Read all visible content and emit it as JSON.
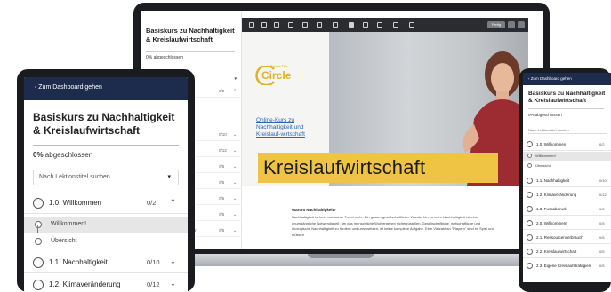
{
  "laptop": {
    "sidebar": {
      "title": "Basiskurs zu Nachhaltigkeit & Kreislaufwirtschaft",
      "progress": "0% abgeschlossen",
      "search_placeholder": "Nach Lektionstitel suchen",
      "rows": [
        {
          "label": "",
          "count": "0/2"
        },
        {
          "label": "",
          "count": "0/10"
        },
        {
          "label": "ng",
          "count": "0/12"
        },
        {
          "label": "",
          "count": "0/5"
        },
        {
          "label": "",
          "count": "0/5"
        },
        {
          "label": "ruch",
          "count": "0/6"
        },
        {
          "label": "",
          "count": "0/5"
        },
        {
          "label": "strategien",
          "count": "0/5"
        },
        {
          "label": "",
          "count": "0/7"
        }
      ]
    },
    "toolbar": {
      "button_label": "Fertig"
    },
    "slide": {
      "brand_small": "Shape The",
      "brand_big": "Circle",
      "subtitle": "Online-Kurs zu Nachhaltigkeit und Kreislauf-wirtschaft",
      "banner": "Kreislaufwirtschaft"
    },
    "article": {
      "title": "Warum Nachhaltigkeit?",
      "body": "Nachhaltigkeit ist kein modischer Trend mehr. Ein gesamtgesellschaftlicher Wandel hin zu mehr Nachhaltigkeit ist eine unumgängliche Notwendigkeit, um das menschliche Wohlergehen sicherzustellen. Gesellschaftliche, wirtschaftliche und ökologische Nachhaltigkeit zu fördern und umzusetzen, ist keine komplexe Aufgabe. Eine Vielzahl an \"Playern\" sind im Spiel und müssen"
    }
  },
  "tablet": {
    "back_label": "Zum Dashboard gehen",
    "title": "Basiskurs zu Nachhaltigkeit & Kreislaufwirtschaft",
    "progress_value": "0%",
    "progress_text": "abgeschlossen",
    "search_placeholder": "Nach Lektionstitel suchen",
    "sections": [
      {
        "label": "1.0. Willkommen",
        "count": "0/2",
        "chevron": "up"
      },
      {
        "label": "1.1. Nachhaltigkeit",
        "count": "0/10",
        "chevron": "down"
      },
      {
        "label": "1.2. Klimaveränderung",
        "count": "0/12",
        "chevron": "down"
      }
    ],
    "items": [
      {
        "label": "Willkommen!",
        "active": true
      },
      {
        "label": "Übersicht",
        "active": false
      }
    ]
  },
  "phone": {
    "back_label": "Zum Dashboard gehen",
    "title": "Basiskurs zu Nachhaltigkeit & Kreislaufwirtschaft",
    "progress": "0% abgeschlossen",
    "search_placeholder": "Nach Lektionstitel suchen",
    "sections": [
      {
        "label": "1.0. Willkommen",
        "count": "0/2"
      },
      {
        "label": "1.1. Nachhaltigkeit",
        "count": "0/10"
      },
      {
        "label": "1.2. Klimaveränderung",
        "count": "0/12"
      },
      {
        "label": "1.3. Fussabdruck",
        "count": "0/5"
      },
      {
        "label": "2.0. Willkommen!",
        "count": "0/5"
      },
      {
        "label": "2.1. Ressourcenverbrauch",
        "count": "0/6"
      },
      {
        "label": "2.2. Kreislaufwirtschaft",
        "count": "0/5"
      },
      {
        "label": "2.3. Eigene Kreislaufstrategien",
        "count": "0/5"
      }
    ],
    "items": [
      {
        "label": "Willkommen!",
        "active": true
      },
      {
        "label": "Übersicht",
        "active": false
      }
    ]
  },
  "colors": {
    "header_navy": "#1d2c4d",
    "banner_yellow": "#efc445",
    "brand_gold": "#e1b12a",
    "link_blue": "#2a62b8"
  }
}
